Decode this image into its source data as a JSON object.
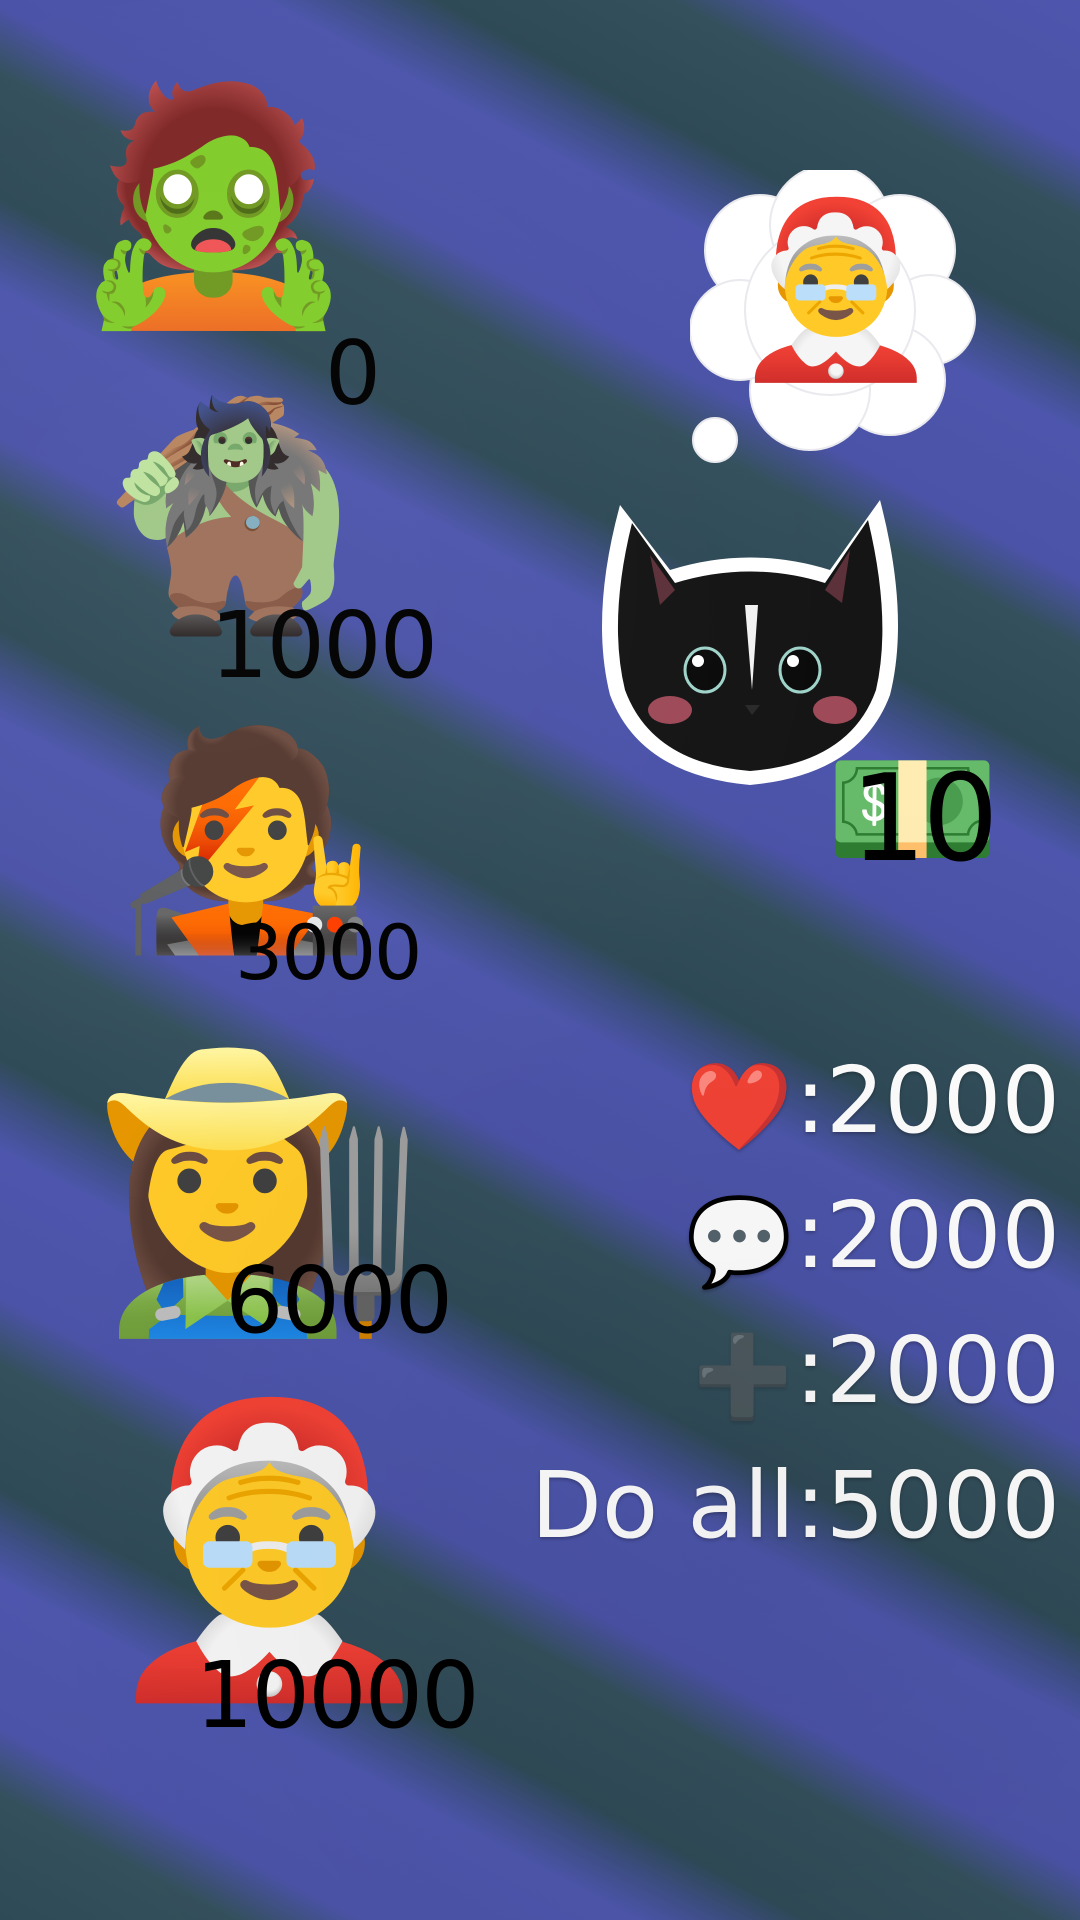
{
  "tiers": [
    {
      "icon": "zombie-emoji",
      "glyph": "🧟",
      "value": "0"
    },
    {
      "icon": "troll-emoji",
      "glyph": "🧌",
      "value": "1000"
    },
    {
      "icon": "singer-emoji",
      "glyph": "🧑‍🎤",
      "value": "3000"
    },
    {
      "icon": "farmer-emoji",
      "glyph": "👩‍🌾",
      "value": "6000"
    },
    {
      "icon": "mrs-claus-emoji",
      "glyph": "🤶",
      "value": "10000"
    }
  ],
  "thought": {
    "icon": "mrs-claus-emoji",
    "glyph": "🤶"
  },
  "money": {
    "icon": "dollar-banknote-emoji",
    "glyph": "💵",
    "value": "10"
  },
  "rules": [
    {
      "icon": "heart-icon",
      "glyph": "❤️",
      "text": ":2000"
    },
    {
      "icon": "speech-bubble-icon",
      "glyph": "💬",
      "text": ":2000"
    },
    {
      "icon": "plus-icon",
      "glyph": "➕",
      "text": ":2000"
    },
    {
      "icon": "",
      "glyph": "",
      "text": "Do all:5000"
    }
  ],
  "colors": {
    "stripe_blue": "#4d56ac",
    "stripe_dark": "#2f4a57",
    "text_white": "#ffffff",
    "text_black": "#000000"
  }
}
